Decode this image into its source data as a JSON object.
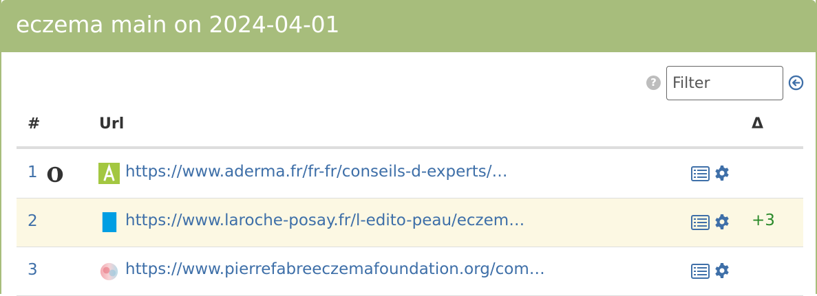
{
  "panel": {
    "title": "eczema main on 2024-04-01"
  },
  "toolbar": {
    "help_icon": "question-circle-icon",
    "help_glyph": "?",
    "filter_placeholder": "Filter",
    "go_icon": "arrow-circle-left-icon"
  },
  "table": {
    "headers": {
      "rank": "#",
      "url": "Url",
      "delta": "Δ"
    },
    "rows": [
      {
        "rank": "1",
        "badge_icon": "half-circle-icon",
        "favicon": "aderma-favicon",
        "url": "https://www.aderma.fr/fr-fr/conseils-d-experts/…",
        "details_icon": "list-icon",
        "settings_icon": "gear-icon",
        "delta": ""
      },
      {
        "rank": "2",
        "favicon": "laroche-posay-favicon",
        "url": "https://www.laroche-posay.fr/l-edito-peau/eczem…",
        "details_icon": "list-icon",
        "settings_icon": "gear-icon",
        "delta": "+3",
        "highlighted": true
      },
      {
        "rank": "3",
        "favicon": "pierre-fabre-favicon",
        "url": "https://www.pierrefabreeczemafoundation.org/com…",
        "details_icon": "list-icon",
        "settings_icon": "gear-icon",
        "delta": ""
      }
    ]
  },
  "colors": {
    "header_bg": "#a7bd7c",
    "link": "#3e6fa8",
    "highlight_row": "#fcf8e3",
    "delta_positive": "#2a8a2a"
  }
}
